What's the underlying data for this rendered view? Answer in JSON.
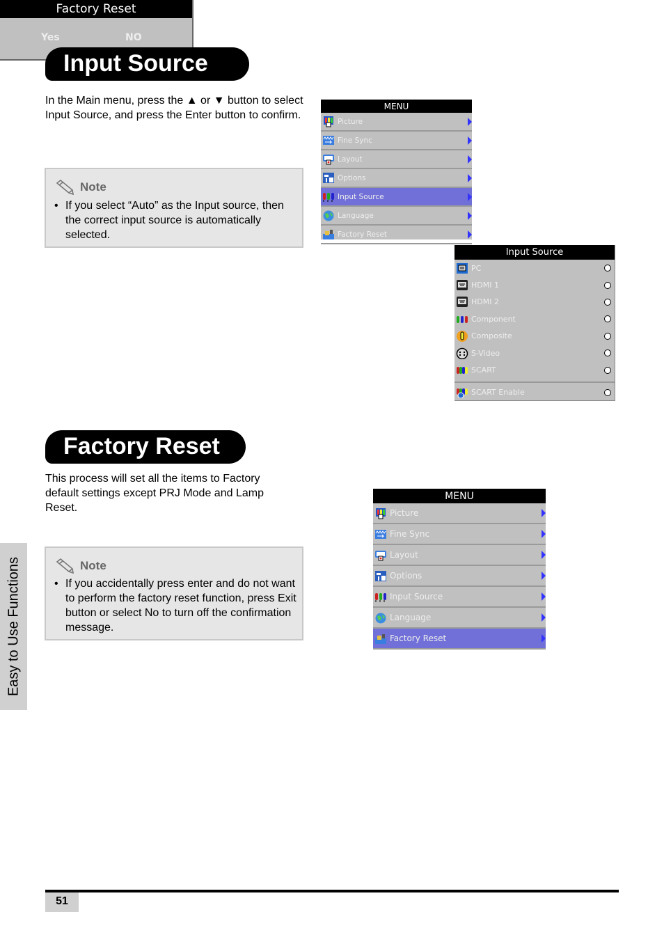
{
  "input_source_section": {
    "title": "Input Source",
    "instruction": "In the Main menu, press the ▲ or ▼ button to select Input Source, and press the Enter button to confirm.",
    "note": {
      "icon": "pencil-icon",
      "label": "Note",
      "bullet": "•",
      "text": "If you select “Auto” as the Input source, then the correct input source is automatically selected."
    },
    "main_menu": {
      "header": "MENU",
      "items": [
        {
          "label": "Picture",
          "icon": "picture-icon",
          "selected": false
        },
        {
          "label": "Fine Sync",
          "icon": "fine-sync-icon",
          "selected": false
        },
        {
          "label": "Layout",
          "icon": "layout-icon",
          "selected": false
        },
        {
          "label": "Options",
          "icon": "options-icon",
          "selected": false
        },
        {
          "label": "Input Source",
          "icon": "input-source-icon",
          "selected": true
        },
        {
          "label": "Language",
          "icon": "language-globe-icon",
          "selected": false
        },
        {
          "label": "Factory Reset",
          "icon": "factory-reset-icon",
          "selected": false
        }
      ]
    },
    "submenu": {
      "header": "Input Source",
      "items": [
        {
          "label": "PC",
          "icon": "pc-icon"
        },
        {
          "label": "HDMI 1",
          "icon": "hdmi-icon"
        },
        {
          "label": "HDMI 2",
          "icon": "hdmi-icon"
        },
        {
          "label": "Component",
          "icon": "component-icon"
        },
        {
          "label": "Composite",
          "icon": "composite-icon"
        },
        {
          "label": "S-Video",
          "icon": "s-video-icon"
        },
        {
          "label": "SCART",
          "icon": "scart-icon"
        }
      ],
      "extra_item": {
        "label": "SCART Enable",
        "icon": "scart-enable-icon"
      }
    }
  },
  "factory_reset_section": {
    "title": "Factory Reset",
    "description": "This process will set all the items to Factory default settings except PRJ Mode and Lamp Reset.",
    "note": {
      "icon": "pencil-icon",
      "label": "Note",
      "bullet": "•",
      "text": "If you accidentally press enter and do not want to perform the factory reset function, press Exit button or select No to turn off the confirmation message."
    },
    "main_menu": {
      "header": "MENU",
      "items": [
        {
          "label": "Picture",
          "icon": "picture-icon",
          "selected": false
        },
        {
          "label": "Fine Sync",
          "icon": "fine-sync-icon",
          "selected": false
        },
        {
          "label": "Layout",
          "icon": "layout-icon",
          "selected": false
        },
        {
          "label": "Options",
          "icon": "options-icon",
          "selected": false
        },
        {
          "label": "Input Source",
          "icon": "input-source-icon",
          "selected": false
        },
        {
          "label": "Language",
          "icon": "language-globe-icon",
          "selected": false
        },
        {
          "label": "Factory Reset",
          "icon": "factory-reset-icon",
          "selected": true
        }
      ]
    },
    "confirm_dialog": {
      "header": "Factory Reset",
      "yes_label": "Yes",
      "no_label": "NO"
    }
  },
  "side_tab": "Easy to Use Functions",
  "page_number": "51",
  "colors": {
    "osd_background": "#c0c0c0",
    "osd_selected": "#7070d8",
    "osd_arrow": "#3333ff",
    "note_background": "#e6e6e6"
  }
}
